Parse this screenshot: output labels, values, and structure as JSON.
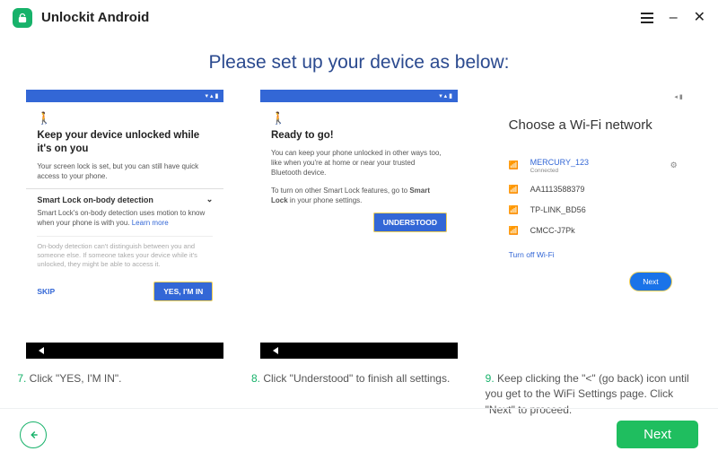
{
  "app": {
    "title": "Unlockit Android"
  },
  "heading": "Please set up your device as below:",
  "screens": {
    "s1": {
      "title": "Keep your device unlocked while it's on you",
      "desc": "Your screen lock is set, but you can still have quick access to your phone.",
      "section_title": "Smart Lock on-body detection",
      "section_body": "Smart Lock's on-body detection uses motion to know when your phone is with you.",
      "learn": "Learn more",
      "disclaimer": "On-body detection can't distinguish between you and someone else. If someone takes your device while it's unlocked, they might be able to access it.",
      "skip": "SKIP",
      "confirm": "YES, I'M IN"
    },
    "s2": {
      "title": "Ready to go!",
      "body1": "You can keep your phone unlocked in other ways too, like when you're at home or near your trusted Bluetooth device.",
      "body2_a": "To turn on other Smart Lock features, go to ",
      "body2_b": "Smart Lock",
      "body2_c": " in your phone settings.",
      "confirm": "UNDERSTOOD"
    },
    "s3": {
      "title": "Choose a Wi-Fi network",
      "items": [
        {
          "ssid": "MERCURY_123",
          "sub": "Connected",
          "active": true
        },
        {
          "ssid": "AA1113588379"
        },
        {
          "ssid": "TP-LINK_BD56"
        },
        {
          "ssid": "CMCC-J7Pk"
        }
      ],
      "turn_off": "Turn off Wi-Fi",
      "next": "Next"
    }
  },
  "captions": {
    "c1_num": "7.",
    "c1": " Click \"YES, I'M IN\".",
    "c2_num": "8.",
    "c2": " Click \"Understood\" to finish all settings.",
    "c3_num": "9.",
    "c3": " Keep clicking the \"<\" (go back) icon until you get to the WiFi Settings page. Click \"Next\" to proceed."
  },
  "footer": {
    "next": "Next"
  }
}
